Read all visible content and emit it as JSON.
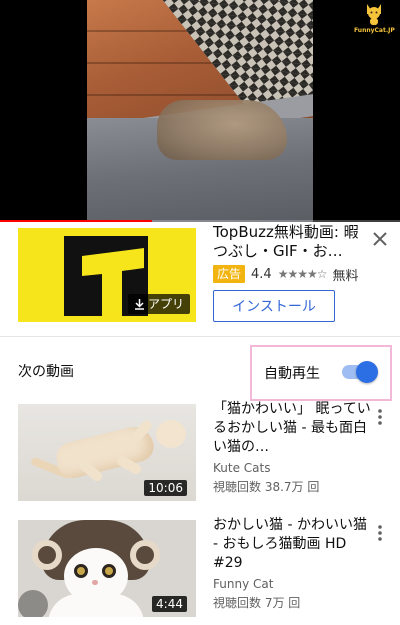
{
  "player": {
    "watermark_text": "FunnyCat.JP",
    "progress_fraction": 0.38,
    "accent_color": "#ff0000"
  },
  "ad": {
    "title": "TopBuzz無料動画: 暇つぶし・GIF・お…",
    "badge": "広告",
    "rating": "4.4",
    "stars": "★★★★☆",
    "price": "無料",
    "app_label": "アプリ",
    "install_label": "インストール",
    "close_icon": "close-icon",
    "accent_color": "#f2b411"
  },
  "upnext": {
    "label": "次の動画",
    "autoplay_label": "自動再生",
    "autoplay_on": true,
    "toggle_color": "#2c6fe4"
  },
  "videos": [
    {
      "title": "「猫かわいい」 眠っているおかしい猫 - 最も面白い猫の…",
      "channel": "Kute Cats",
      "views": "視聴回数 38.7万 回",
      "duration": "10:06"
    },
    {
      "title": "おかしい猫 - かわいい猫 - おもしろ猫動画 HD #29",
      "channel": "Funny Cat",
      "views": "視聴回数 7万 回",
      "duration": "4:44"
    }
  ]
}
